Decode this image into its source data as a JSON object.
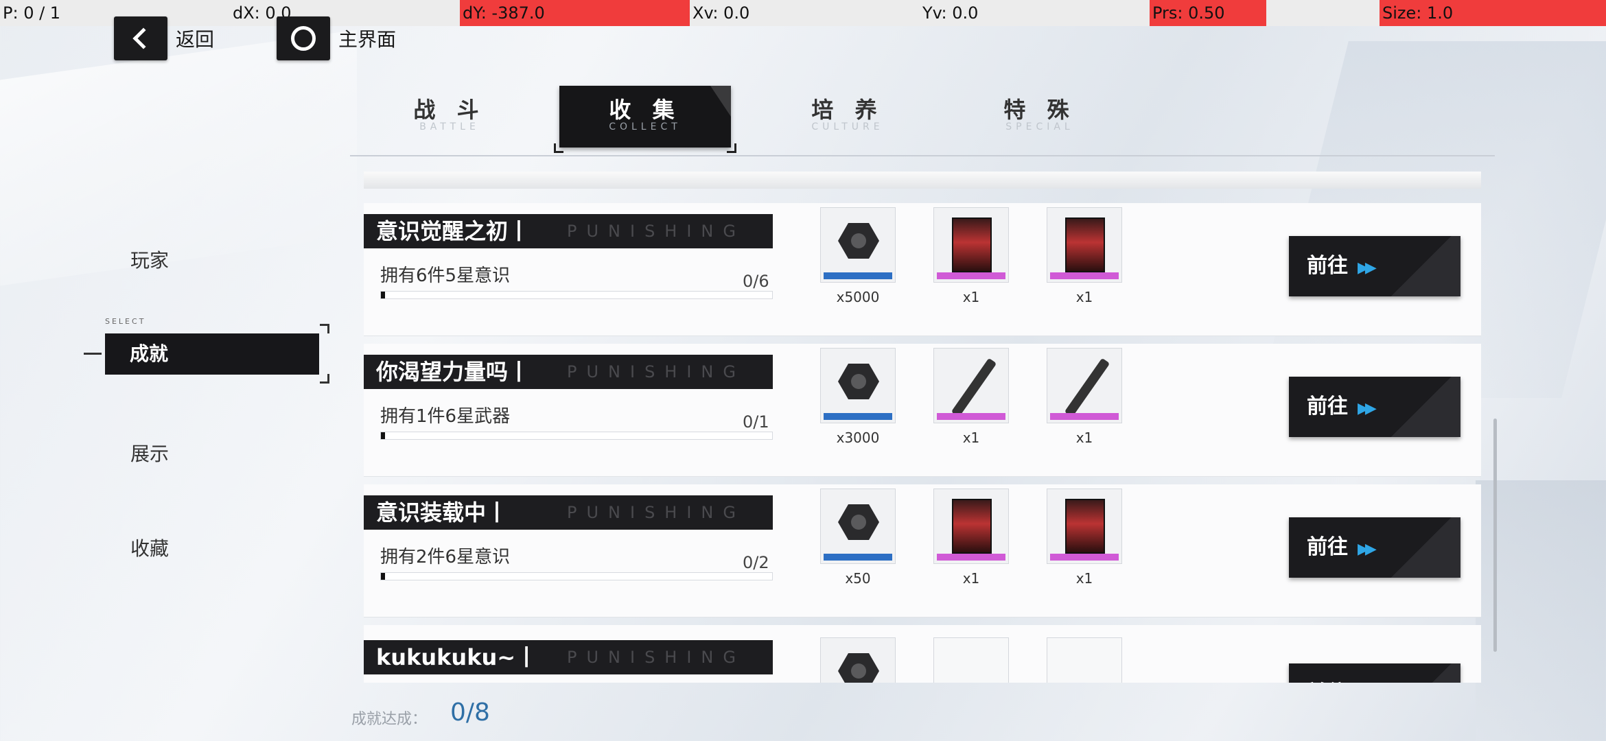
{
  "debug": {
    "p": "P: 0 / 1",
    "dx": "dX: 0.0",
    "dy": "dY: -387.0",
    "xv": "Xv: 0.0",
    "yv": "Yv: 0.0",
    "prs": "Prs: 0.50",
    "size": "Size: 1.0",
    "highlight_color": "#f03c3c"
  },
  "nav": {
    "back_label": "返回",
    "home_label": "主界面"
  },
  "tabs": [
    {
      "label": "战 斗",
      "sub": "BATTLE",
      "active": false
    },
    {
      "label": "收 集",
      "sub": "COLLECT",
      "active": true
    },
    {
      "label": "培 养",
      "sub": "CULTURE",
      "active": false
    },
    {
      "label": "特 殊",
      "sub": "SPECIAL",
      "active": false
    }
  ],
  "sidebar": {
    "select_tag": "SELECT",
    "items": [
      {
        "label": "玩家"
      },
      {
        "label": "成就"
      },
      {
        "label": "展示"
      },
      {
        "label": "收藏"
      }
    ]
  },
  "achievements": [
    {
      "title": "意识觉醒之初丨",
      "tag": "PUNISHING",
      "desc": "拥有6件5星意识",
      "progress": "0/6",
      "rewards": [
        {
          "icon": "hex-nut-icon",
          "qty": "x5000",
          "tier_color": "#2d6fc4"
        },
        {
          "icon": "awareness-card-icon",
          "qty": "x1",
          "tier_color": "#d05ad6"
        },
        {
          "icon": "awareness-card-icon",
          "qty": "x1",
          "tier_color": "#d05ad6"
        }
      ],
      "button": "前往"
    },
    {
      "title": "你渴望力量吗丨",
      "tag": "PUNISHING",
      "desc": "拥有1件6星武器",
      "progress": "0/1",
      "rewards": [
        {
          "icon": "hex-nut-icon",
          "qty": "x3000",
          "tier_color": "#2d6fc4"
        },
        {
          "icon": "weapon-icon",
          "qty": "x1",
          "tier_color": "#d05ad6"
        },
        {
          "icon": "weapon-icon",
          "qty": "x1",
          "tier_color": "#d05ad6"
        }
      ],
      "button": "前往"
    },
    {
      "title": "意识装载中丨",
      "tag": "PUNISHING",
      "desc": "拥有2件6星意识",
      "progress": "0/2",
      "rewards": [
        {
          "icon": "hex-nut-icon",
          "qty": "x50",
          "tier_color": "#2d6fc4"
        },
        {
          "icon": "awareness-card-icon",
          "qty": "x1",
          "tier_color": "#d05ad6"
        },
        {
          "icon": "awareness-card-icon",
          "qty": "x1",
          "tier_color": "#d05ad6"
        }
      ],
      "button": "前往"
    },
    {
      "title": "kukukuku~丨",
      "tag": "PUNISHING",
      "desc": "",
      "progress": "",
      "rewards": [
        {
          "icon": "hex-nut-icon",
          "qty": "",
          "tier_color": "#2d6fc4"
        },
        {
          "icon": "empty-slot",
          "qty": "",
          "tier_color": ""
        },
        {
          "icon": "empty-slot",
          "qty": "",
          "tier_color": ""
        }
      ],
      "button": "前往"
    }
  ],
  "footer": {
    "label": "成就达成：",
    "value": "0/8"
  },
  "colors": {
    "accent_blue": "#2fa6e6",
    "dark_panel": "#1b1b1e"
  }
}
